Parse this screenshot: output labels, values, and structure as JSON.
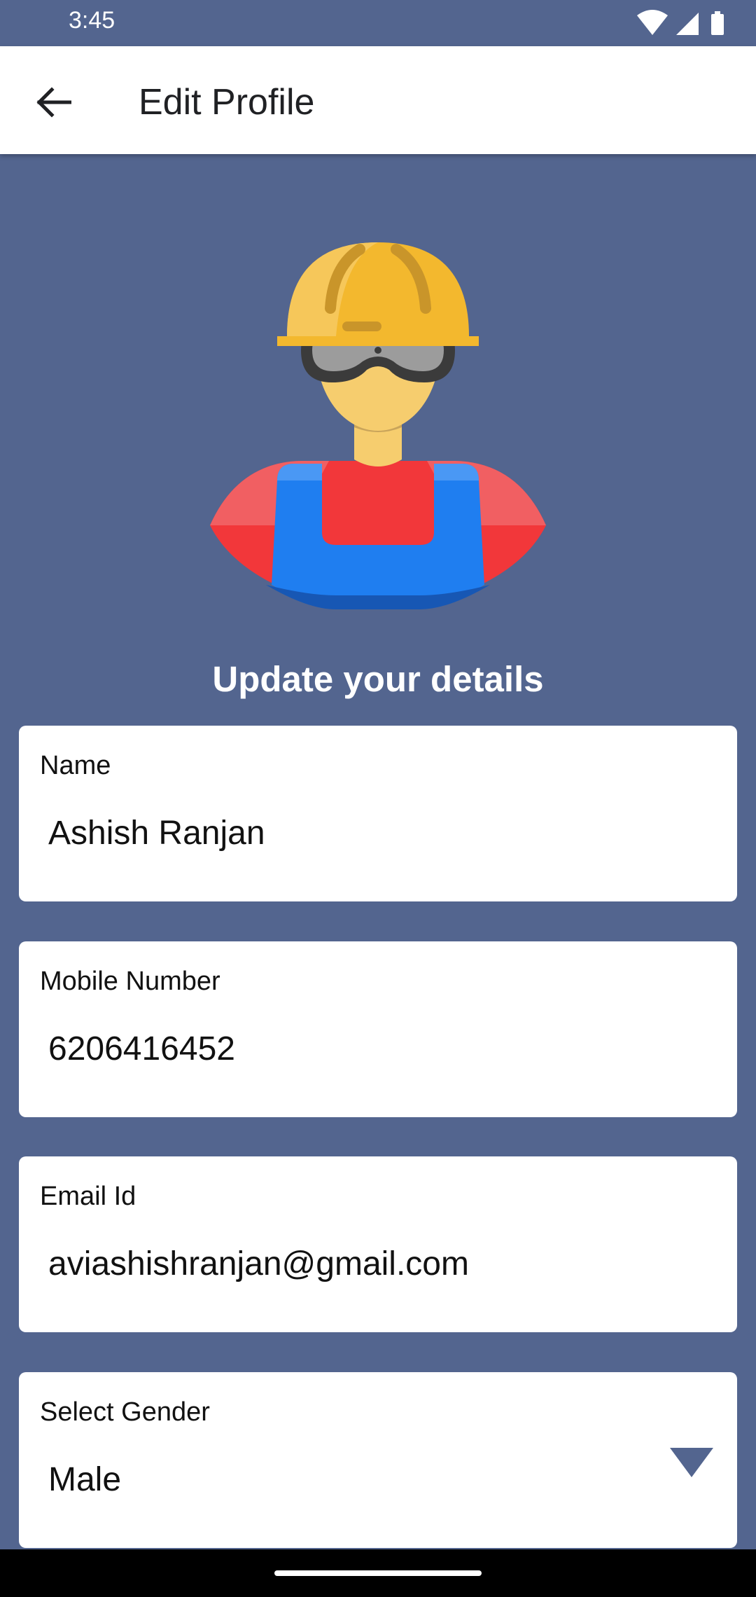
{
  "status_bar": {
    "time": "3:45",
    "icons": [
      "wifi-icon",
      "signal-icon",
      "battery-icon"
    ]
  },
  "app_bar": {
    "title": "Edit Profile",
    "back_icon": "arrow-left-icon"
  },
  "main": {
    "heading": "Update your details",
    "avatar_icon": "construction-worker-avatar",
    "fields": [
      {
        "label": "Name",
        "value": "Ashish Ranjan"
      },
      {
        "label": "Mobile Number",
        "value": "6206416452"
      },
      {
        "label": "Email Id",
        "value": "aviashishranjan@gmail.com"
      }
    ],
    "gender": {
      "label": "Select Gender",
      "selected": "Male",
      "dropdown_icon": "triangle-down-icon"
    }
  },
  "colors": {
    "background": "#53658f",
    "app_bar": "#ffffff",
    "card": "#ffffff",
    "dropdown_arrow": "#53658f",
    "nav_bar": "#000000"
  }
}
